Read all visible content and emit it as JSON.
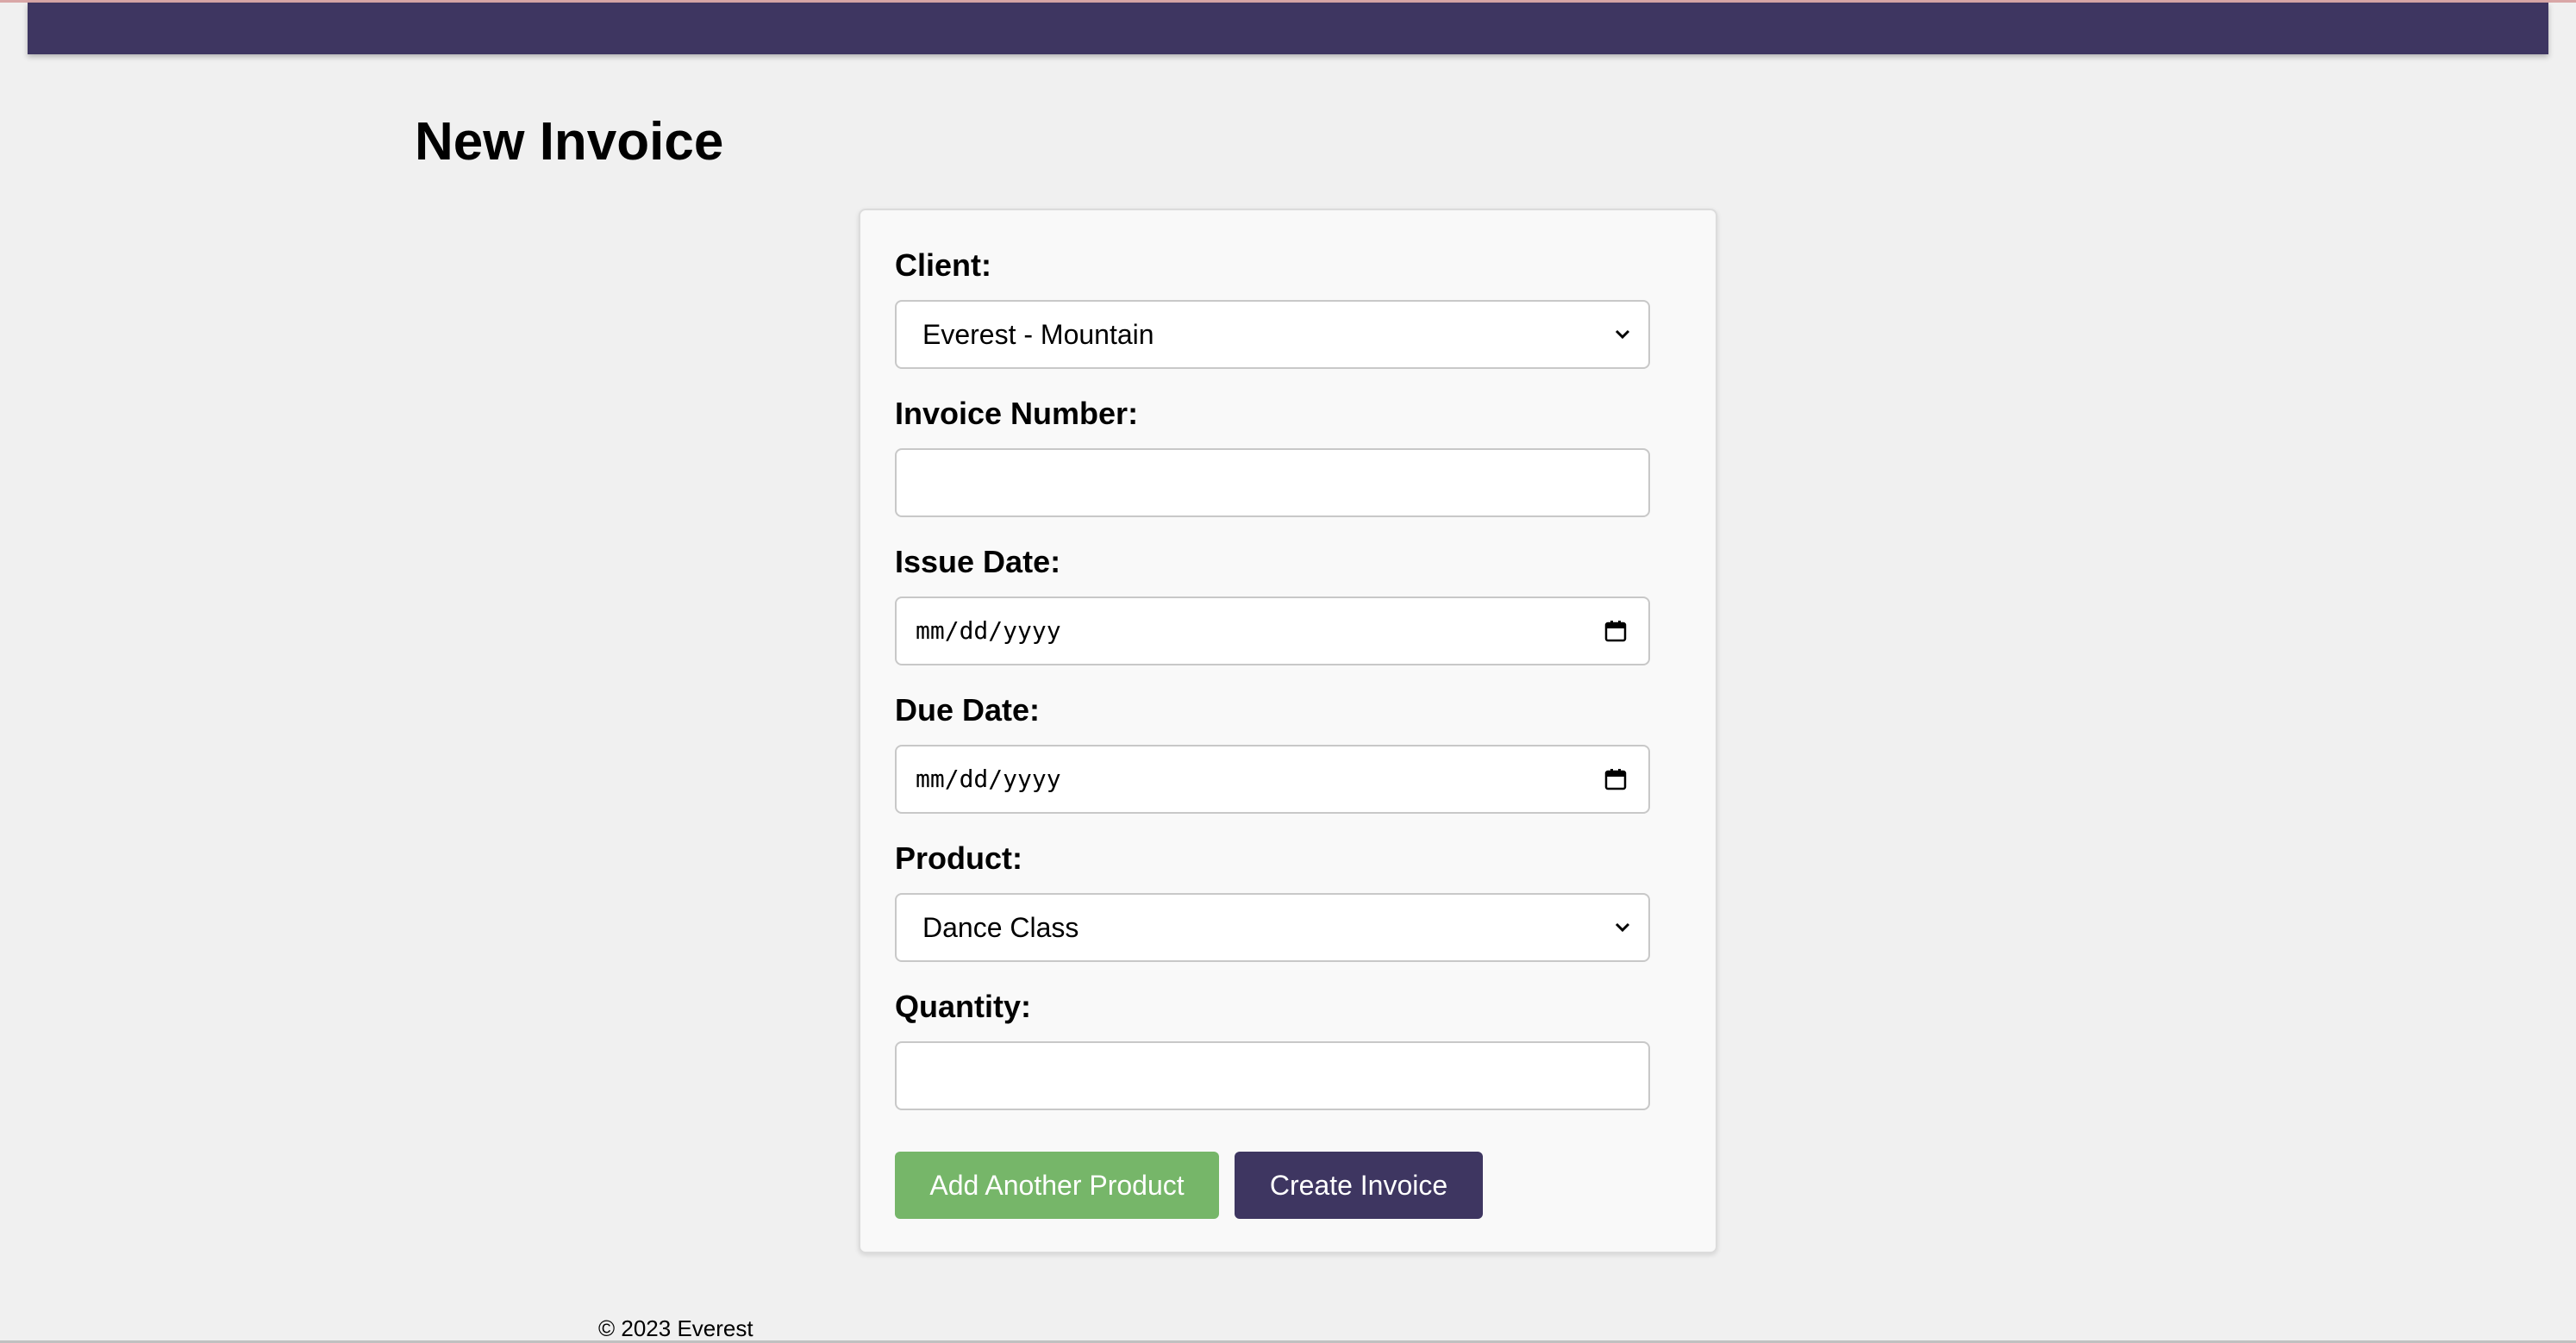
{
  "page": {
    "title": "New Invoice",
    "footer": "© 2023 Everest"
  },
  "form": {
    "client": {
      "label": "Client:",
      "selected": "Everest - Mountain"
    },
    "invoice_number": {
      "label": "Invoice Number:",
      "value": ""
    },
    "issue_date": {
      "label": "Issue Date:",
      "placeholder": "mm/dd/yyyy"
    },
    "due_date": {
      "label": "Due Date:",
      "placeholder": "mm/dd/yyyy"
    },
    "product": {
      "label": "Product:",
      "selected": "Dance Class"
    },
    "quantity": {
      "label": "Quantity:",
      "value": ""
    }
  },
  "actions": {
    "add_product": "Add Another Product",
    "create_invoice": "Create Invoice"
  },
  "colors": {
    "header": "#3e3661",
    "add_button": "#76b669",
    "create_button": "#3e3661",
    "background": "#f0f0f0"
  },
  "icons": {
    "select_arrow": "chevron-down-icon",
    "date_picker": "calendar-icon"
  }
}
